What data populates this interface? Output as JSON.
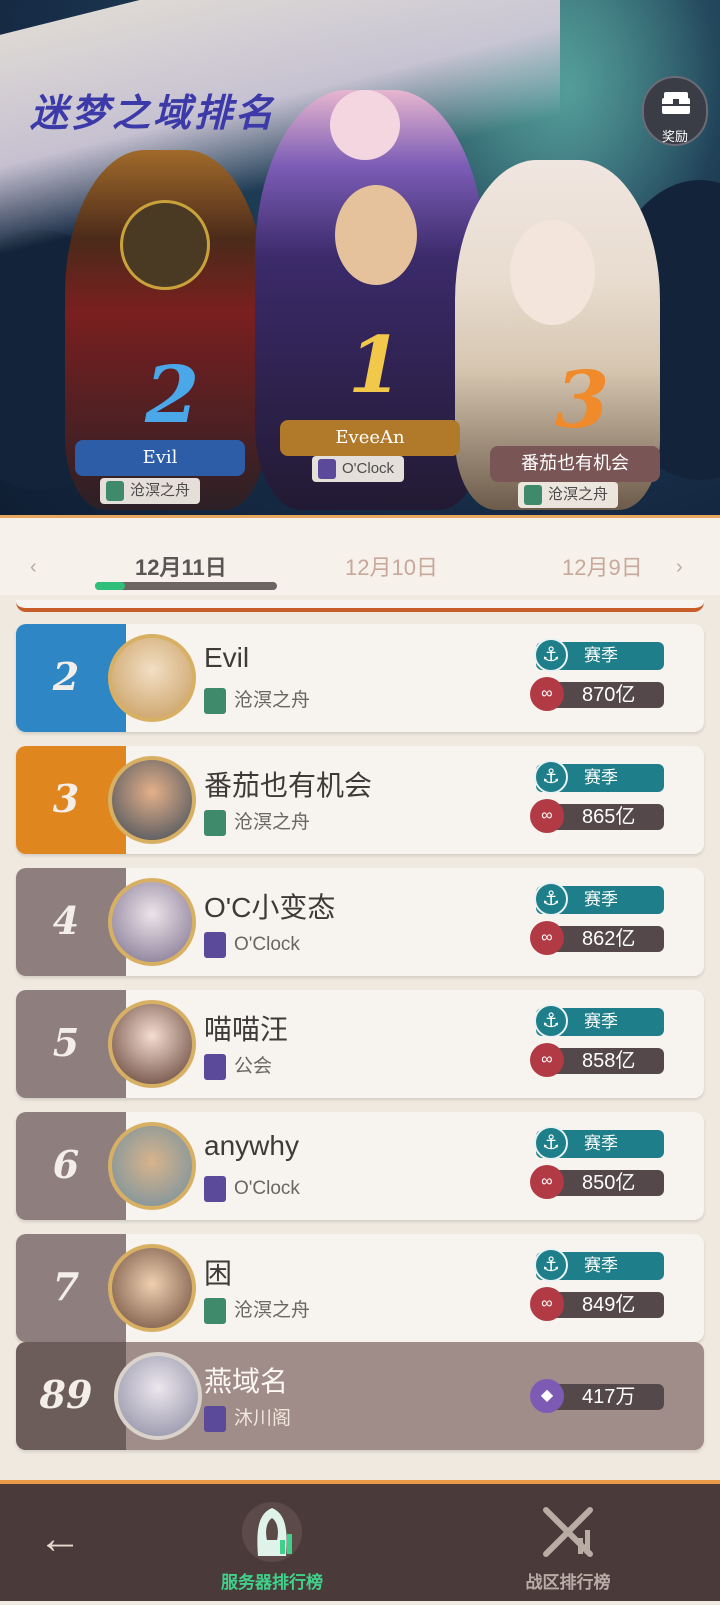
{
  "page": {
    "title": "迷梦之域排名"
  },
  "reward": {
    "label": "奖励",
    "icon": "chest-icon"
  },
  "podium": [
    {
      "rank": "2",
      "name": "Evil",
      "guild": "沧溟之舟",
      "plate_color": "#2d5da6",
      "rank_color": "#4aa7e8"
    },
    {
      "rank": "1",
      "name": "EveeAn",
      "guild": "O'Clock",
      "plate_color": "#b07a2a",
      "rank_color": "#f2c84b"
    },
    {
      "rank": "3",
      "name": "番茄也有机会",
      "guild": "沧溟之舟",
      "plate_color": "#7a5555",
      "rank_color": "#f08a2a"
    }
  ],
  "date_tabs": [
    {
      "label": "12月11日",
      "active": true
    },
    {
      "label": "12月10日",
      "active": false
    },
    {
      "label": "12月9日",
      "active": false
    }
  ],
  "rows": [
    {
      "rank": "2",
      "name": "Evil",
      "guild": "沧溟之舟",
      "season": "赛季",
      "score": "870亿",
      "rank_bg": "#2f86c5",
      "guild_icon_color": "#3e8a6a"
    },
    {
      "rank": "3",
      "name": "番茄也有机会",
      "guild": "沧溟之舟",
      "season": "赛季",
      "score": "865亿",
      "rank_bg": "#e0861f",
      "guild_icon_color": "#3e8a6a"
    },
    {
      "rank": "4",
      "name": "O'C小变态",
      "guild": "O'Clock",
      "season": "赛季",
      "score": "862亿",
      "rank_bg": "#8e7e7d",
      "guild_icon_color": "#5b4a9a"
    },
    {
      "rank": "5",
      "name": "喵喵汪",
      "guild": "公会",
      "season": "赛季",
      "score": "858亿",
      "rank_bg": "#8e7e7d",
      "guild_icon_color": "#5b4a9a"
    },
    {
      "rank": "6",
      "name": "anywhy",
      "guild": "O'Clock",
      "season": "赛季",
      "score": "850亿",
      "rank_bg": "#8e7e7d",
      "guild_icon_color": "#5b4a9a"
    },
    {
      "rank": "7",
      "name": "困",
      "guild": "沧溟之舟",
      "season": "赛季",
      "score": "849亿",
      "rank_bg": "#8e7e7d",
      "guild_icon_color": "#3e8a6a"
    }
  ],
  "self_row": {
    "rank": "89",
    "name": "燕域名",
    "guild": "沐川阁",
    "score": "417万"
  },
  "bottom_nav": {
    "back_icon": "back-arrow-icon",
    "server_rank": {
      "label": "服务器排行榜",
      "active": true,
      "color": "#3fd08a"
    },
    "zone_rank": {
      "label": "战区排行榜",
      "active": false,
      "color": "#b9aca5"
    }
  }
}
